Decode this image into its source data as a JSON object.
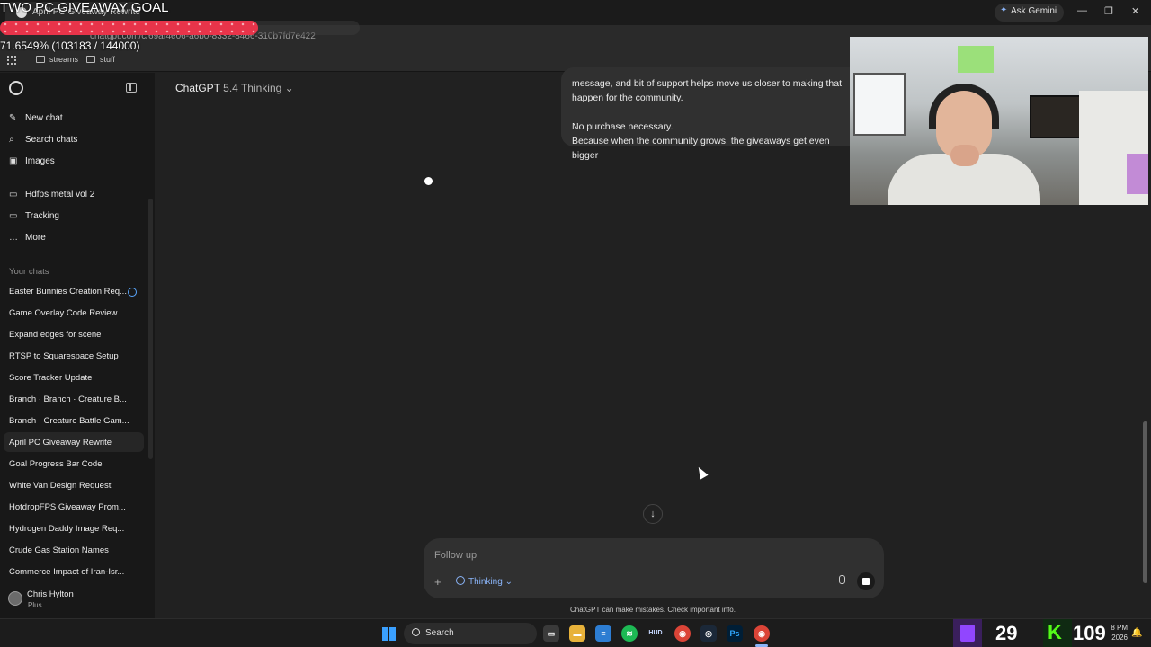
{
  "overlay": {
    "goal_title": "TWO PC GIVEAWAY GOAL",
    "goal_progress_text": "71.6549% (103183 / 144000)",
    "goal_fraction": 0.716549,
    "goal_color": "#e8344a"
  },
  "browser": {
    "tab_title": "April PC Giveaway Rewrite",
    "ask_gemini": "Ask Gemini",
    "url": "chatgpt.com/c/69af4e06-a6b0-8332-8466-310b7fd7e422",
    "bookmarks": [
      "streams",
      "stuff"
    ],
    "window_controls": [
      "—",
      "❐",
      "✕"
    ]
  },
  "sidebar": {
    "nav": [
      {
        "label": "New chat",
        "icon": "pencil-icon"
      },
      {
        "label": "Search chats",
        "icon": "search-icon"
      },
      {
        "label": "Images",
        "icon": "image-icon"
      },
      {
        "label": "Hdfps metal vol 2",
        "icon": "folder-icon"
      },
      {
        "label": "Tracking",
        "icon": "folder-icon"
      },
      {
        "label": "More",
        "icon": "more-icon"
      }
    ],
    "section_label": "Your chats",
    "chats": [
      "Easter Bunnies Creation Req...",
      "Game Overlay Code Review",
      "Expand edges for scene",
      "RTSP to Squarespace Setup",
      "Score Tracker Update",
      "Branch · Branch · Creature B...",
      "Branch · Creature Battle Gam...",
      "April PC Giveaway Rewrite",
      "Goal Progress Bar Code",
      "White Van Design Request",
      "HotdropFPS Giveaway Prom...",
      "Hydrogen Daddy Image Req...",
      "Crude Gas Station Names",
      "Commerce Impact of Iran-Isr..."
    ],
    "active_chat_index": 7,
    "user": {
      "name": "Chris Hylton",
      "plan": "Plus"
    }
  },
  "main": {
    "model_name": "ChatGPT",
    "model_version": "5.4 Thinking",
    "message": {
      "line1": "message, and bit of support helps move us closer to making that",
      "line2": "happen for the community.",
      "line3": "No purchase necessary.",
      "line4": "Because when the community grows, the giveaways get even bigger"
    },
    "composer": {
      "placeholder": "Follow up",
      "mode_label": "Thinking"
    },
    "disclaimer": "ChatGPT can make mistakes. Check important info."
  },
  "taskbar": {
    "search_label": "Search",
    "twitch_count": "29",
    "kick_count": "109",
    "time": "8 PM",
    "date": "2026",
    "apps": [
      "taskview",
      "files",
      "notepad",
      "spotify",
      "hud",
      "chrome",
      "steam",
      "photoshop",
      "chrome-active"
    ]
  }
}
